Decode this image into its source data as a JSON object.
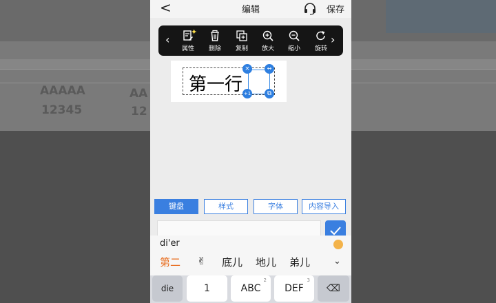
{
  "header": {
    "back_glyph": "<",
    "title": "编辑",
    "save_label": "保存",
    "support_icon": "headset-icon"
  },
  "toolbar": {
    "tools": [
      {
        "label": "属性",
        "icon": "edit-properties-icon"
      },
      {
        "label": "删除",
        "icon": "trash-icon"
      },
      {
        "label": "复制",
        "icon": "copy-icon"
      },
      {
        "label": "放大",
        "icon": "zoom-in-icon"
      },
      {
        "label": "缩小",
        "icon": "zoom-out-icon"
      },
      {
        "label": "旋转",
        "icon": "rotate-icon"
      }
    ],
    "prev_glyph": "‹",
    "next_glyph": "›"
  },
  "canvas": {
    "text": "第一行",
    "handles": {
      "delete": "×",
      "resize": "↔",
      "add": "+1",
      "copy": "⧉"
    }
  },
  "tabs": [
    {
      "label": "键盘",
      "active": true
    },
    {
      "label": "样式",
      "active": false
    },
    {
      "label": "字体",
      "active": false
    },
    {
      "label": "内容导入",
      "active": false
    }
  ],
  "input": {
    "value": ""
  },
  "keyboard": {
    "pinyin": "di'er",
    "candidates": [
      "第二",
      "✌",
      "底儿",
      "地儿",
      "弟儿"
    ],
    "more_glyph": "⌄",
    "keys": [
      {
        "label": "die",
        "sup": ""
      },
      {
        "label": "1",
        "sup": ""
      },
      {
        "label": "ABC",
        "sup": "2"
      },
      {
        "label": "DEF",
        "sup": "3"
      },
      {
        "label": "⌫",
        "sup": ""
      }
    ]
  },
  "colors": {
    "accent": "#3a7fe0",
    "candidate_highlight": "#e86d1f",
    "toolbar_bg": "#151515"
  }
}
